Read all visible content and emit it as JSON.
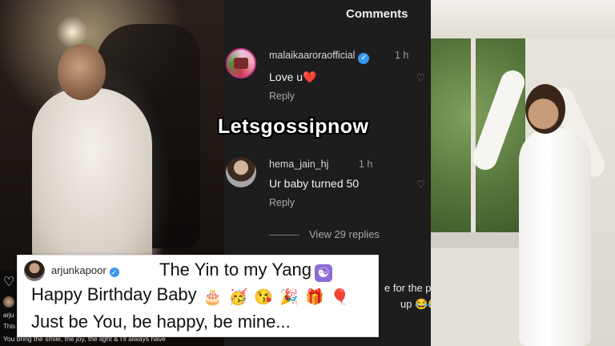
{
  "watermark": "Letsgossipnow",
  "comments_panel": {
    "title": "Comments",
    "comments": [
      {
        "username": "malaikaaroraofficial",
        "verified": true,
        "time": "1 h",
        "text": "Love u❤️",
        "reply_label": "Reply"
      },
      {
        "username": "hema_jain_hj",
        "verified": false,
        "time": "1 h",
        "text": "Ur baby turned 50",
        "reply_label": "Reply"
      }
    ],
    "view_replies": "View 29 replies",
    "partial_text_1": "e for the p",
    "partial_text_2": "up 😂😂"
  },
  "left_panel": {
    "heart_icon": "heart-outline-icon",
    "partial_username": "arju",
    "partial_text": "This",
    "bottom_caption": "You bring the smile, the joy, the light & I'll always have"
  },
  "caption": {
    "username": "arjunkapoor",
    "verified": true,
    "line1": "The Yin to my Yang",
    "line1_icon": "☯",
    "line2": "Happy Birthday Baby",
    "line2_emojis": [
      "🎂",
      "🥳",
      "😘",
      "🎉",
      "🎁",
      "🎈"
    ],
    "line3": "Just be You, be happy, be mine..."
  },
  "colors": {
    "comments_bg": "#1d1d1d",
    "verified_blue": "#3897f0",
    "heart_red": "#e0245e",
    "yinyang_purple": "#8e6bd6"
  }
}
